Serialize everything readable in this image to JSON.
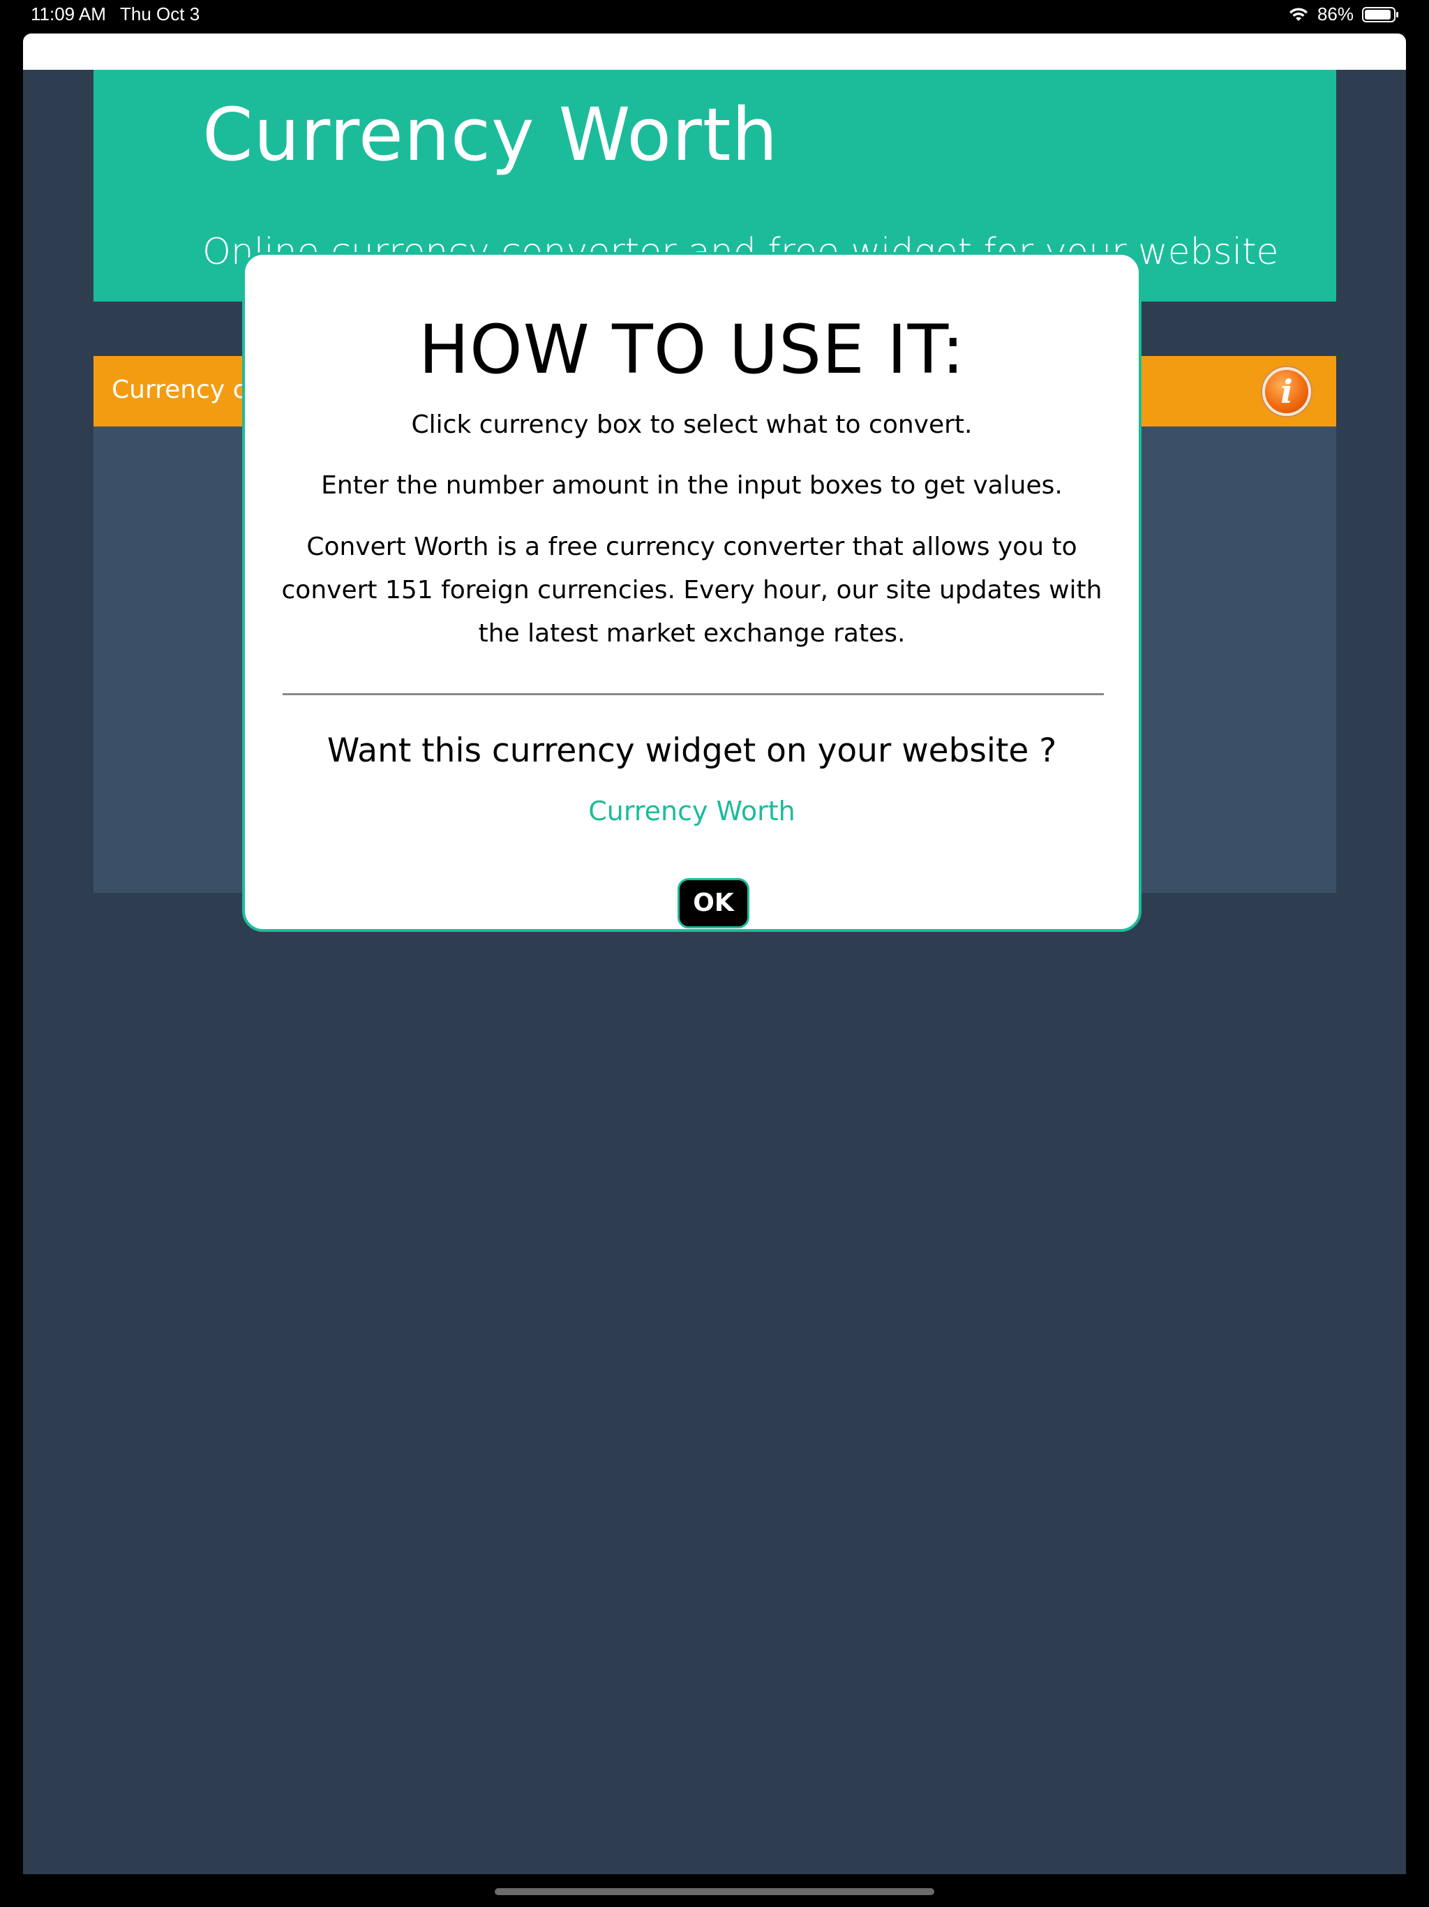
{
  "status_bar": {
    "time": "11:09 AM",
    "date": "Thu Oct 3",
    "battery": "86%",
    "icons": [
      "wifi-icon",
      "battery-icon"
    ]
  },
  "header": {
    "title": "Currency Worth",
    "subtitle": "Online currency converter and free widget for your website"
  },
  "converter": {
    "label": "Currency con",
    "info_icon": "info-icon",
    "info_glyph": "i"
  },
  "modal": {
    "title": "HOW TO USE IT:",
    "line1": "Click currency box to select what to convert.",
    "line2": "Enter the number amount in the input boxes to get values.",
    "line3": "Convert Worth is a free currency converter that allows you to convert 151 foreign currencies. Every hour, our site updates with the latest market exchange rates.",
    "widget_question": "Want this currency widget on your website ?",
    "widget_link": "Currency Worth",
    "ok_label": "OK"
  },
  "colors": {
    "header_teal": "#1cbc9b",
    "bar_orange": "#f39c12",
    "page_bg": "#2e3e50",
    "body_blue": "#3b5067"
  }
}
